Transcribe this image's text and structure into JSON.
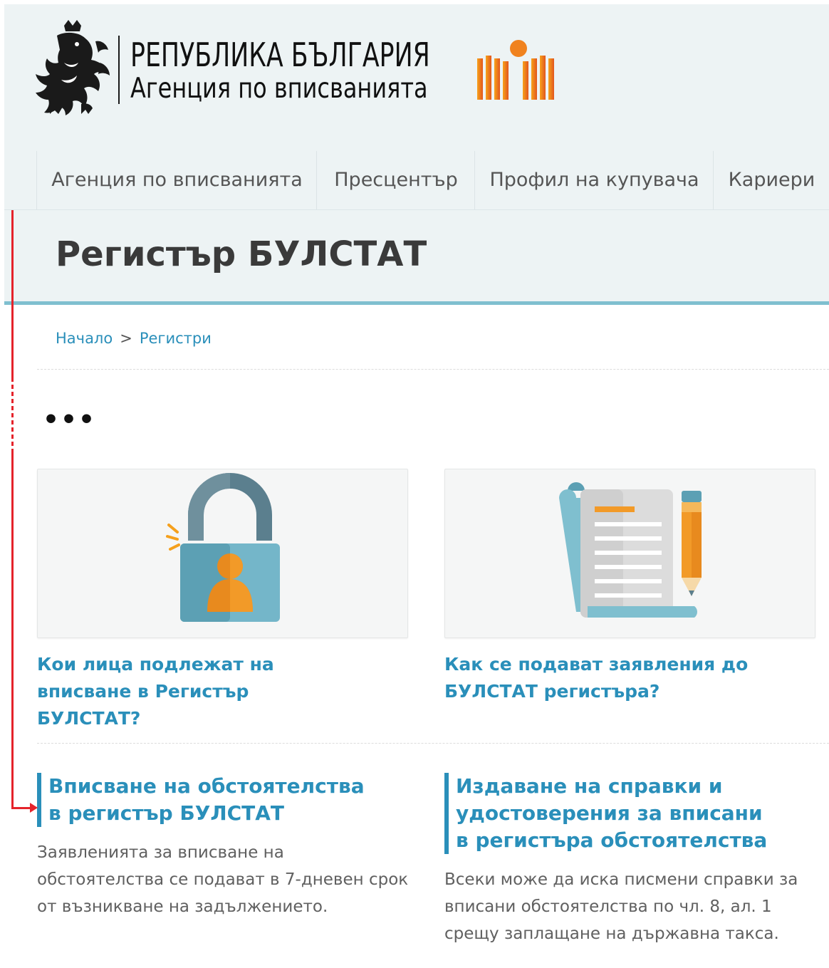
{
  "header": {
    "logo_title": "РЕПУБЛИКА БЪЛГАРИЯ",
    "logo_subtitle": "Агенция по вписванията"
  },
  "nav": {
    "items": [
      {
        "label": "Агенция по вписванията"
      },
      {
        "label": "Пресцентър"
      },
      {
        "label": "Профил на купувача"
      },
      {
        "label": "Кариери"
      }
    ]
  },
  "page": {
    "title": "Регистър БУЛСТАТ"
  },
  "breadcrumb": {
    "home": "Начало",
    "separator": ">",
    "current": "Регистри"
  },
  "more": {
    "label": "•••"
  },
  "cards": [
    {
      "icon": "lock-person-icon",
      "link": "Кои лица подлежат на вписване в Регистър БУЛСТАТ?"
    },
    {
      "icon": "document-pencil-icon",
      "link": "Как се подават заявления до БУЛСТАТ регистъра?"
    }
  ],
  "sections": [
    {
      "title": "Вписване на обстоятелства в регистър БУЛСТАТ",
      "text": "Заявленията за вписване на обстоятелства се подават в 7-дневен срок от възникване на задължението."
    },
    {
      "title": "Издаване на справки и удостоверения за вписани в регистъра обстоятелства",
      "text": "Всеки може да иска писмени справки за вписани обстоятелства по чл. 8, ал. 1 срещу заплащане на държавна такса."
    }
  ],
  "colors": {
    "accent": "#2a8fba",
    "header_bg": "#edf3f4",
    "annotation": "#e5232b",
    "logo_orange": "#f0821e"
  }
}
